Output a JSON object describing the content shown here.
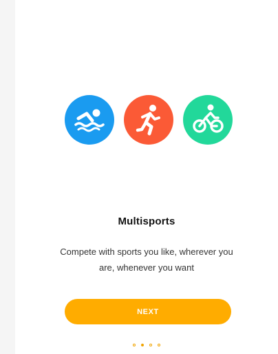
{
  "onboarding": {
    "title": "Multisports",
    "description": "Compete with sports you like, wherever you are, whenever you want",
    "next_label": "NEXT",
    "page_count": 4,
    "active_page": 2
  },
  "sports": [
    {
      "icon": "swim-icon",
      "color": "#1a9bf0"
    },
    {
      "icon": "run-icon",
      "color": "#fb5a36"
    },
    {
      "icon": "bike-icon",
      "color": "#22d89a"
    }
  ],
  "colors": {
    "accent": "#ffac00",
    "dot": "#f0a300"
  }
}
